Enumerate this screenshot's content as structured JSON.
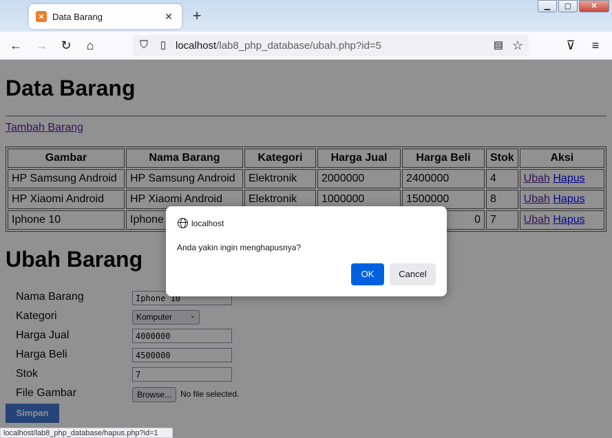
{
  "browser": {
    "tab_title": "Data Barang",
    "new_tab_glyph": "+",
    "url_host": "localhost",
    "url_path": "/lab8_php_database/ubah.php?id=5",
    "icons": [
      "back-icon",
      "forward-icon",
      "reload-icon",
      "home-icon",
      "shield-icon",
      "page-icon",
      "reader-view-icon",
      "bookmark-star-icon",
      "pocket-icon",
      "menu-icon"
    ]
  },
  "page": {
    "title": "Data Barang",
    "add_link": "Tambah Barang",
    "table": {
      "headers": [
        "Gambar",
        "Nama Barang",
        "Kategori",
        "Harga Jual",
        "Harga Beli",
        "Stok",
        "Aksi"
      ],
      "rows": [
        {
          "gambar": "HP Samsung Android",
          "nama": "HP Samsung Android",
          "kategori": "Elektronik",
          "jual": "2000000",
          "beli": "2400000",
          "stok": "4"
        },
        {
          "gambar": "HP Xiaomi Android",
          "nama": "HP Xiaomi Android",
          "kategori": "Elektronik",
          "jual": "1000000",
          "beli": "1500000",
          "stok": "8"
        },
        {
          "gambar": "Iphone 10",
          "nama": "Iphone 1",
          "kategori": "",
          "jual": "",
          "beli": "0",
          "stok": "7"
        }
      ],
      "action_edit": "Ubah",
      "action_delete": "Hapus"
    },
    "form": {
      "title": "Ubah Barang",
      "label_nama": "Nama Barang",
      "label_kategori": "Kategori",
      "label_jual": "Harga Jual",
      "label_beli": "Harga Beli",
      "label_stok": "Stok",
      "label_file": "File Gambar",
      "value_nama": "Iphone 10",
      "value_kategori": "Komputer",
      "value_jual": "4000000",
      "value_beli": "4500000",
      "value_stok": "7",
      "browse_label": "Browse...",
      "file_status": "No file selected.",
      "submit_label": "Simpan"
    }
  },
  "status_url": "localhost/lab8_php_database/hapus.php?id=1",
  "dialog": {
    "host": "localhost",
    "message": "Anda yakin ingin menghapusnya?",
    "ok_label": "OK",
    "cancel_label": "Cancel",
    "ok_color": "#0061e0"
  }
}
